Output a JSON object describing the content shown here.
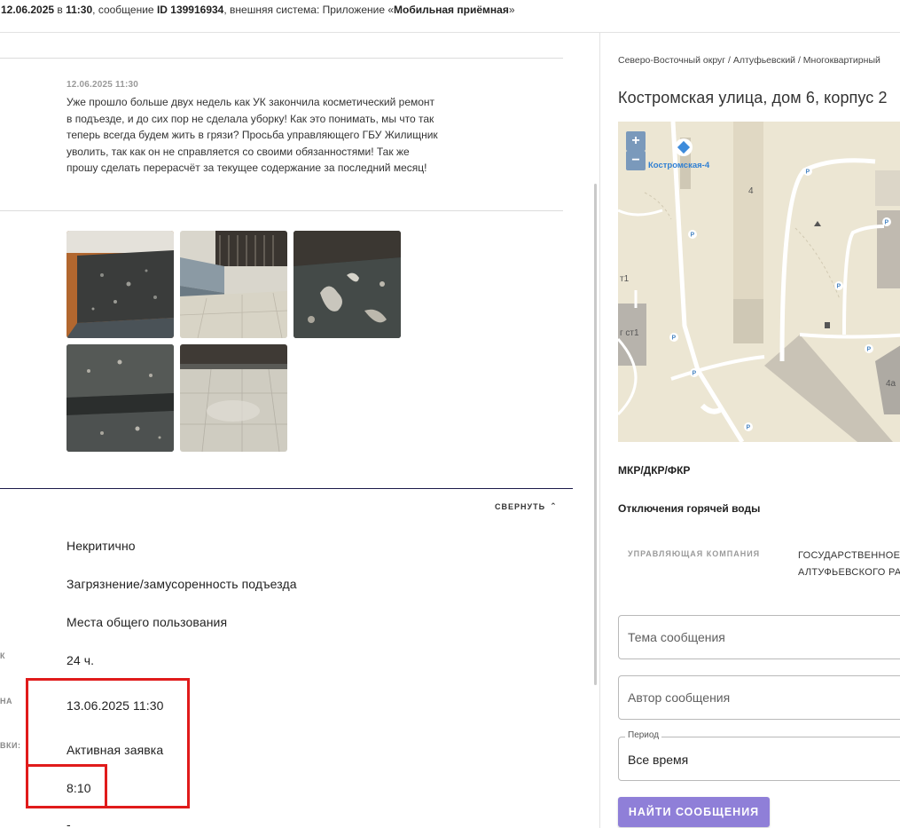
{
  "header": {
    "date": "12.06.2025",
    "in_word": "в",
    "time": "11:30",
    "message_word": ", сообщение",
    "message_id": "ID 139916934",
    "external_prefix": ", внешняя система: Приложение «",
    "external_name": "Мобильная приёмная",
    "external_suffix": "»"
  },
  "message": {
    "date": "12.06.2025 11:30",
    "text": "Уже прошло больше двух недель как УК закончила косметический ремонт в подъезде, и до сих пор не сделала уборку! Как это понимать, мы что так теперь всегда будем жить в грязи? Просьба управляющего ГБУ Жилищник уволить, так как он не справляется со своими обязанностями! Так же прошу сделать перерасчёт за текущее содержание за последний месяц!"
  },
  "collapse_label": "СВЕРНУТЬ",
  "details": {
    "criticality": "Некритично",
    "problem": "Загрязнение/замусоренность подъезда",
    "category": "Места общего пользования",
    "deadline_hours": "24 ч.",
    "deadline_date": "13.06.2025 11:30",
    "status": "Активная заявка",
    "time_left": "8:10",
    "dash": "-",
    "label_frag_1": "К",
    "label_frag_2": "НА",
    "label_frag_3": "ВКИ:"
  },
  "right": {
    "breadcrumb": "Северо-Восточный округ / Алтуфьевский / Многоквартирный",
    "address": "Костромская улица, дом 6, корпус 2",
    "map": {
      "zoom_in": "+",
      "zoom_out": "−",
      "stop_label": "Костромская-4",
      "bld_4": "4",
      "bld_gst1": "г ст1",
      "bld_st1": "т1",
      "bld_4a": "4а",
      "parking": "P"
    },
    "section_mkr": "МКР/ДКР/ФКР",
    "section_hotwater": "Отключения горячей воды",
    "uk_label": "УПРАВЛЯЮЩАЯ КОМПАНИЯ",
    "uk_value_line1": "ГОСУДАРСТВЕННОЕ",
    "uk_value_line2": "АЛТУФЬЕВСКОГО РА",
    "topic_placeholder": "Тема сообщения",
    "author_placeholder": "Автор сообщения",
    "period_label": "Период",
    "period_value": "Все время",
    "search_button": "НАЙТИ СООБЩЕНИЯ"
  },
  "colors": {
    "accent_button": "#8f7fd8",
    "highlight_box": "#e01b1b",
    "section_divider": "#1c1a4a"
  }
}
